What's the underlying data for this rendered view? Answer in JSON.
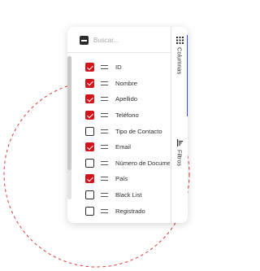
{
  "search": {
    "placeholder": "Buscar..."
  },
  "columns": [
    {
      "label": "ID",
      "checked": true
    },
    {
      "label": "Nombre",
      "checked": true
    },
    {
      "label": "Apellido",
      "checked": true
    },
    {
      "label": "Teléfono",
      "checked": true
    },
    {
      "label": "Tipo de Contacto",
      "checked": false
    },
    {
      "label": "Email",
      "checked": true
    },
    {
      "label": "Número de Documento",
      "checked": false
    },
    {
      "label": "País",
      "checked": true
    },
    {
      "label": "Black List",
      "checked": false
    },
    {
      "label": "Registrado",
      "checked": false
    }
  ],
  "side_tabs": [
    {
      "label": "Columnas",
      "icon": "grid-icon",
      "active": true
    },
    {
      "label": "Filtros",
      "icon": "filter-icon",
      "active": false
    }
  ],
  "colors": {
    "checked": "#d4141c",
    "active_tab": "#3c5ad6",
    "decor_circle": "#e23b3b"
  }
}
